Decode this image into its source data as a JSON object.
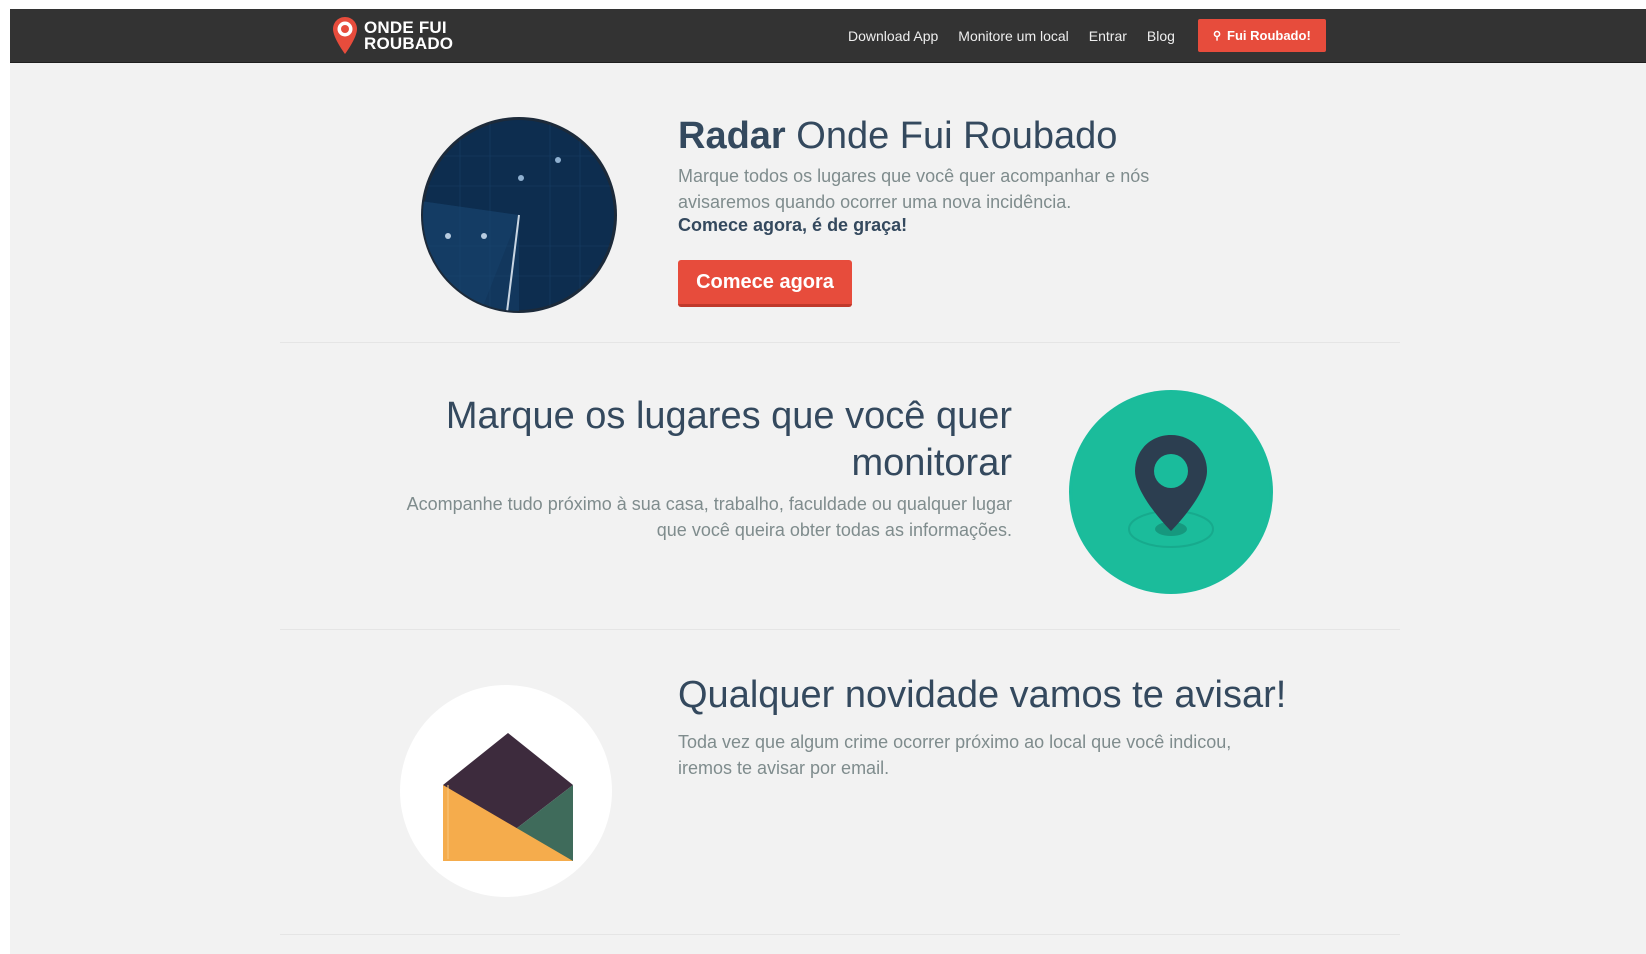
{
  "navbar": {
    "logo_line1": "ONDE FUI",
    "logo_line2": "ROUBADO",
    "links": [
      "Download App",
      "Monitore um local",
      "Entrar",
      "Blog"
    ],
    "cta_label": "Fui Roubado!",
    "cta_icon": "map-pin-icon",
    "cta_color": "#e74c3c"
  },
  "hero": {
    "title_bold": "Radar",
    "title_light": "Onde Fui Roubado",
    "description": "Marque todos os lugares que você quer acompanhar e nós avisaremos quando ocorrer uma nova incidência.",
    "emphasis": "Comece agora, é de graça!",
    "button_label": "Comece agora",
    "illustration": "radar-icon"
  },
  "feature_monitor": {
    "title": "Marque os lugares que você quer monitorar",
    "description": "Acompanhe tudo próximo à sua casa, trabalho, faculdade ou qualquer lugar que você queira obter todas as informações.",
    "illustration": "location-pin-icon",
    "accent_color": "#1abc9c"
  },
  "feature_notify": {
    "title": "Qualquer novidade vamos te avisar!",
    "description": "Toda vez que algum crime ocorrer próximo ao local que você indicou, iremos te avisar por email.",
    "illustration": "envelope-icon"
  },
  "colors": {
    "navbar_bg": "#333333",
    "page_bg": "#f2f2f2",
    "heading": "#34495e",
    "text": "#7f8c8d",
    "accent_red": "#e74c3c",
    "radar_navy": "#0d2d4f"
  }
}
